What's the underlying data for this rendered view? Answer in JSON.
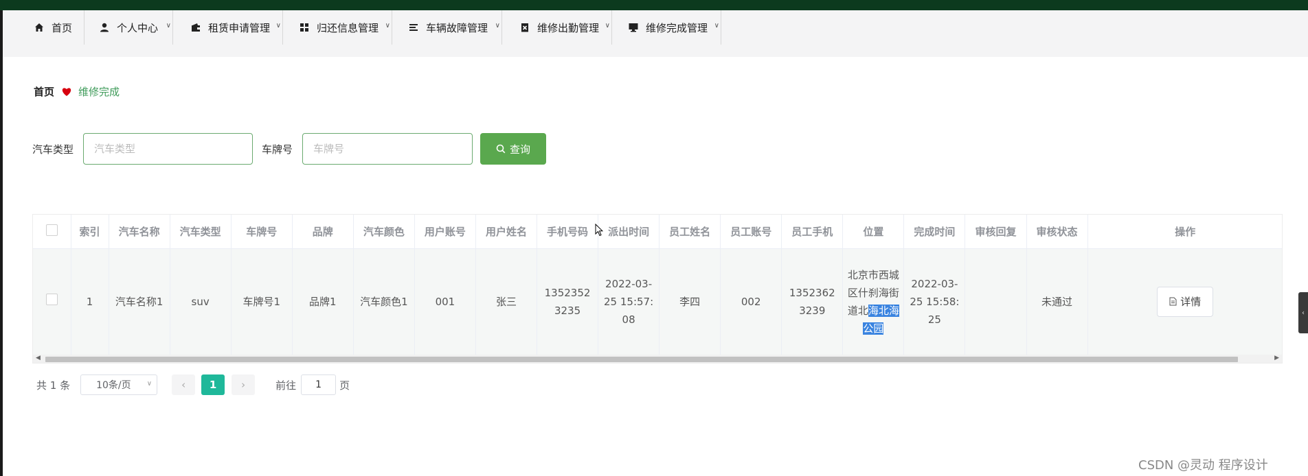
{
  "nav": {
    "items": [
      {
        "label": "首页",
        "icon": "home-icon"
      },
      {
        "label": "个人中心",
        "icon": "user-icon"
      },
      {
        "label": "租赁申请管理",
        "icon": "wallet-icon"
      },
      {
        "label": "归还信息管理",
        "icon": "grid-icon"
      },
      {
        "label": "车辆故障管理",
        "icon": "list-icon"
      },
      {
        "label": "维修出勤管理",
        "icon": "clipboard-x-icon"
      },
      {
        "label": "维修完成管理",
        "icon": "monitor-icon"
      }
    ]
  },
  "breadcrumb": {
    "home": "首页",
    "current": "维修完成"
  },
  "search": {
    "car_type_label": "汽车类型",
    "car_type_placeholder": "汽车类型",
    "plate_label": "车牌号",
    "plate_placeholder": "车牌号",
    "button_label": "查询"
  },
  "table": {
    "headers": [
      "索引",
      "汽车名称",
      "汽车类型",
      "车牌号",
      "品牌",
      "汽车颜色",
      "用户账号",
      "用户姓名",
      "手机号码",
      "派出时间",
      "员工姓名",
      "员工账号",
      "员工手机",
      "位置",
      "完成时间",
      "审核回复",
      "审核状态",
      "操作"
    ],
    "rows": [
      {
        "index": "1",
        "car_name": "汽车名称1",
        "car_type": "suv",
        "plate": "车牌号1",
        "brand": "品牌1",
        "color": "汽车颜色1",
        "user_account": "001",
        "user_name": "张三",
        "phone": "13523523235",
        "dispatch_time": "2022-03-25 15:57:08",
        "staff_name": "李四",
        "staff_account": "002",
        "staff_phone": "13523623239",
        "location_plain": "北京市西城区什刹海街道北",
        "location_selected": "海北海公园",
        "finish_time": "2022-03-25 15:58:25",
        "review_reply": "",
        "review_status": "未通过",
        "action_label": "详情"
      }
    ]
  },
  "pagination": {
    "total_text": "共 1 条",
    "page_size": "10条/页",
    "current_page": "1",
    "goto_label": "前往",
    "goto_value": "1",
    "page_suffix": "页"
  },
  "watermark": "CSDN @灵动 程序设计",
  "colors": {
    "topbar": "#0c3a1e",
    "primary_button": "#5aa84e",
    "active_page": "#1fb89a",
    "breadcrumb_current": "#3f9b5a",
    "selection": "#3a84e0"
  }
}
